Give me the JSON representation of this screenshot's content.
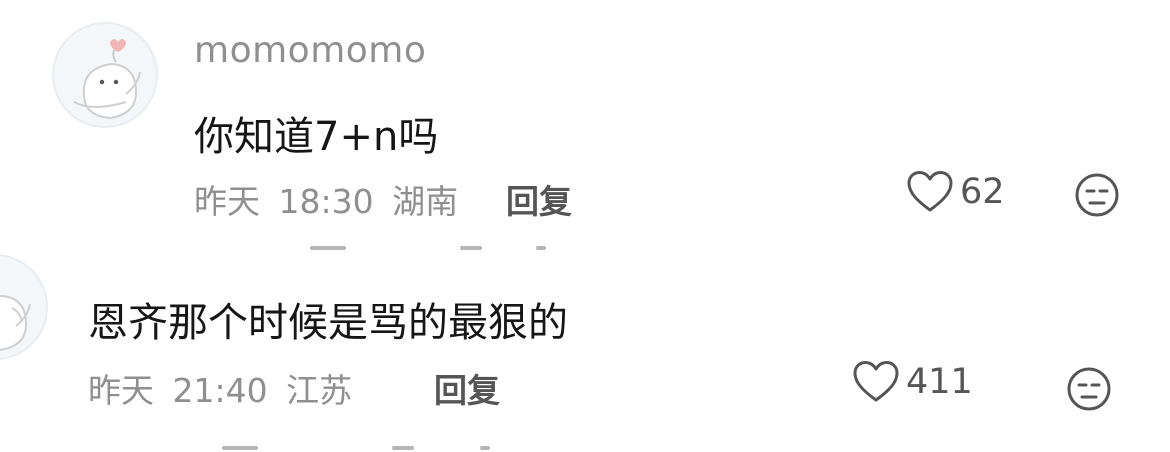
{
  "comments": [
    {
      "username": "momomomo",
      "text": "你知道7+n吗",
      "date": "昨天",
      "time": "18:30",
      "location": "湖南",
      "reply_label": "回复",
      "likes": "62",
      "avatar_icon": "cartoon-avatar-icon"
    },
    {
      "username": "",
      "text": "恩齐那个时候是骂的最狠的",
      "date": "昨天",
      "time": "21:40",
      "location": "江苏",
      "reply_label": "回复",
      "likes": "411",
      "avatar_icon": "cartoon-avatar-icon"
    }
  ],
  "colors": {
    "meta_gray": "#8f8f8f",
    "text_dark": "#161616",
    "icon_gray": "#555555"
  }
}
